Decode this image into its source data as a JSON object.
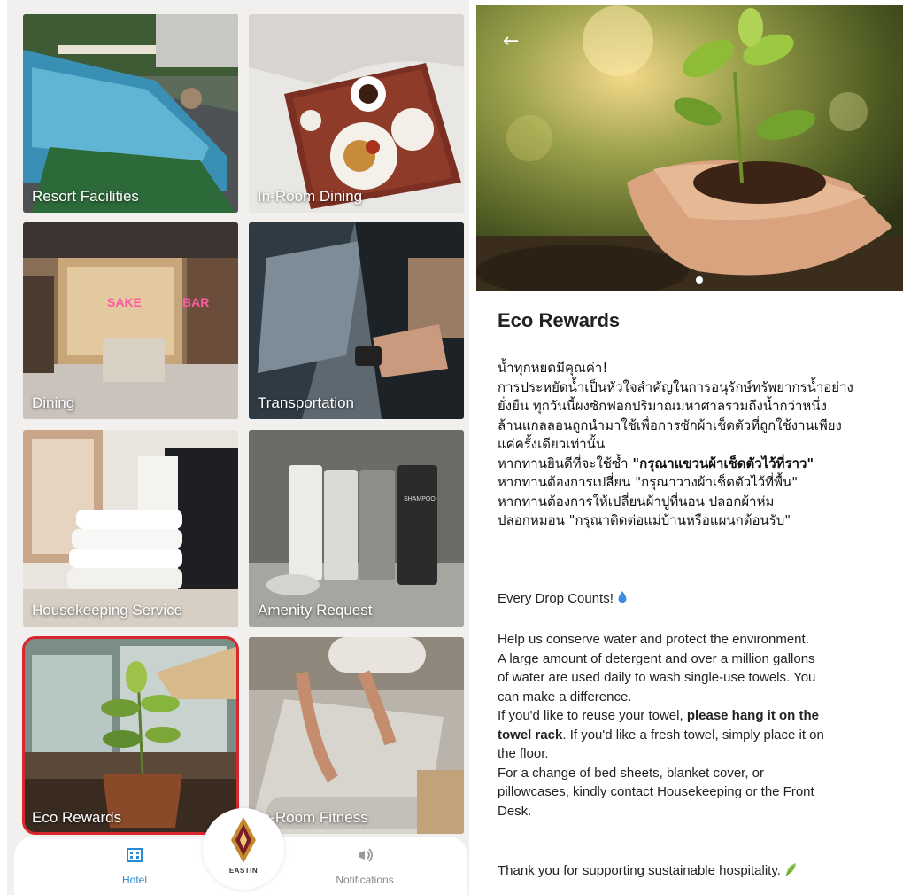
{
  "tiles": [
    {
      "label": "Resort Facilities"
    },
    {
      "label": "In-Room Dining"
    },
    {
      "label": "Dining"
    },
    {
      "label": "Transportation"
    },
    {
      "label": "Housekeeping Service"
    },
    {
      "label": "Amenity Request"
    },
    {
      "label": "Eco Rewards"
    },
    {
      "label": "In-Room Fitness"
    }
  ],
  "nav": {
    "hotel_label": "Hotel",
    "notifications_label": "Notifications",
    "logo_text": "EASTIN"
  },
  "colors": {
    "accent": "#2a8ad4",
    "selection": "#d7262c"
  },
  "detail": {
    "back_icon": "arrow-left-icon",
    "title": "Eco Rewards",
    "thai_lines": [
      "น้ำทุกหยดมีคุณค่า!",
      "การประหยัดน้ำเป็นหัวใจสำคัญในการอนุรักษ์ทรัพยากรน้ำอย่าง",
      "ยั่งยืน ทุกวันนี้ผงซักฟอกปริมาณมหาศาลรวมถึงน้ำกว่าหนึ่ง",
      "ล้านแกลลอนถูกนำมาใช้เพื่อการซักผ้าเช็ดตัวที่ถูกใช้งานเพียง",
      "แค่ครั้งเดียวเท่านั้น",
      "หากท่านยินดีที่จะใช้ซ้ำ ",
      "\"กรุณาแขวนผ้าเช็ดตัวไว้ที่ราว\"",
      "หากท่านต้องการเปลี่ยน \"กรุณาวางผ้าเช็ดตัวไว้ที่พื้น\"",
      "หากท่านต้องการให้เปลี่ยนผ้าปูที่นอน ปลอกผ้าห่ม",
      "ปลอกหมอน \"กรุณาติดต่อแม่บ้านหรือแผนกต้อนรับ\""
    ],
    "every_drop": "Every Drop Counts! ",
    "en_lines": [
      "Help us conserve water and protect the environment.",
      "A large amount of detergent and over a million gallons",
      "of water are used daily to wash single-use towels. You",
      "can make a difference.",
      "If you'd like to reuse your towel, ",
      "please hang it on the",
      "towel rack",
      ". If you'd like a fresh towel, simply place it on",
      "the floor.",
      "For a change of bed sheets, blanket cover, or",
      "pillowcases, kindly contact Housekeeping or the Front",
      "Desk."
    ],
    "thanks": "Thank you for supporting sustainable hospitality. "
  }
}
